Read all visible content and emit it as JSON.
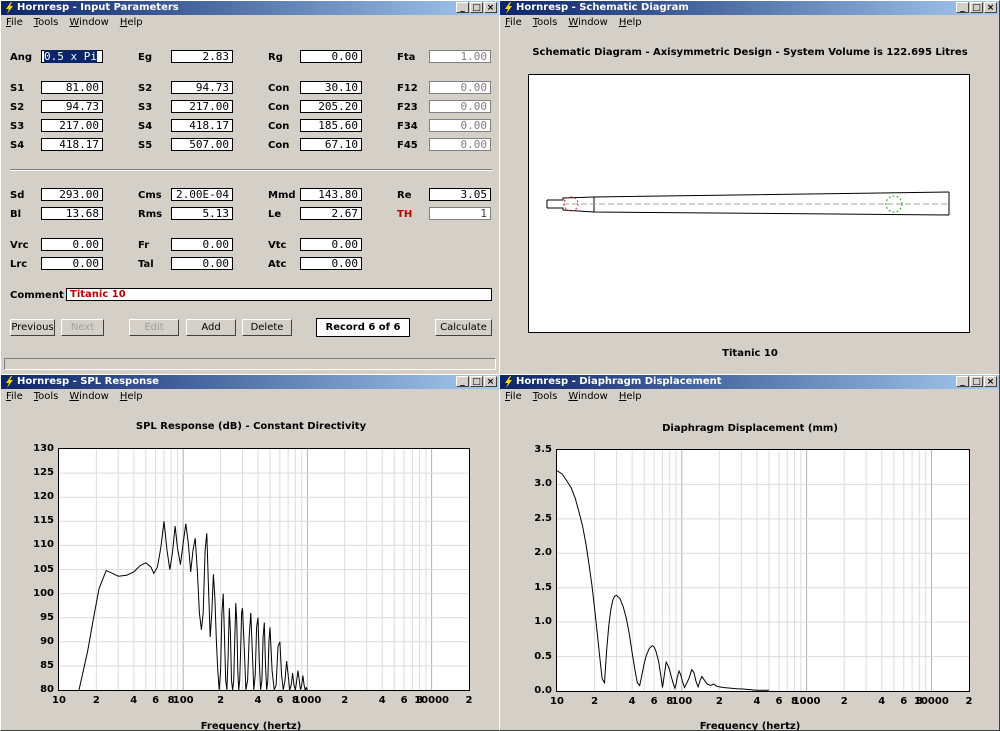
{
  "app_title": "Hornresp",
  "menu": [
    "File",
    "Tools",
    "Window",
    "Help"
  ],
  "windows": {
    "input": {
      "title": "Hornresp - Input Parameters"
    },
    "schematic": {
      "title": "Hornresp - Schematic Diagram",
      "heading": "Schematic Diagram - Axisymmetric Design - System Volume is 122.695 Litres",
      "caption": "Titanic 10"
    },
    "spl": {
      "title": "Hornresp - SPL Response"
    },
    "disp": {
      "title": "Hornresp - Diaphragm Displacement"
    }
  },
  "params": {
    "ang": {
      "label": "Ang",
      "value": "0.5 x Pi"
    },
    "eg": {
      "label": "Eg",
      "value": "2.83"
    },
    "rg": {
      "label": "Rg",
      "value": "0.00"
    },
    "fta": {
      "label": "Fta",
      "value": "1.00"
    },
    "s1": {
      "label": "S1",
      "value": "81.00"
    },
    "s2a": {
      "label": "S2",
      "value": "94.73"
    },
    "con1": {
      "label": "Con",
      "value": "30.10"
    },
    "f12": {
      "label": "F12",
      "value": "0.00"
    },
    "s2b": {
      "label": "S2",
      "value": "94.73"
    },
    "s3a": {
      "label": "S3",
      "value": "217.00"
    },
    "con2": {
      "label": "Con",
      "value": "205.20"
    },
    "f23": {
      "label": "F23",
      "value": "0.00"
    },
    "s3b": {
      "label": "S3",
      "value": "217.00"
    },
    "s4a": {
      "label": "S4",
      "value": "418.17"
    },
    "con3": {
      "label": "Con",
      "value": "185.60"
    },
    "f34": {
      "label": "F34",
      "value": "0.00"
    },
    "s4b": {
      "label": "S4",
      "value": "418.17"
    },
    "s5": {
      "label": "S5",
      "value": "507.00"
    },
    "con4": {
      "label": "Con",
      "value": "67.10"
    },
    "f45": {
      "label": "F45",
      "value": "0.00"
    },
    "sd": {
      "label": "Sd",
      "value": "293.00"
    },
    "cms": {
      "label": "Cms",
      "value": "2.00E-04"
    },
    "mmd": {
      "label": "Mmd",
      "value": "143.80"
    },
    "re": {
      "label": "Re",
      "value": "3.05"
    },
    "bl": {
      "label": "Bl",
      "value": "13.68"
    },
    "rms": {
      "label": "Rms",
      "value": "5.13"
    },
    "le": {
      "label": "Le",
      "value": "2.67"
    },
    "th": {
      "label": "TH",
      "value": "1"
    },
    "vrc": {
      "label": "Vrc",
      "value": "0.00"
    },
    "fr": {
      "label": "Fr",
      "value": "0.00"
    },
    "vtc": {
      "label": "Vtc",
      "value": "0.00"
    },
    "lrc": {
      "label": "Lrc",
      "value": "0.00"
    },
    "tal": {
      "label": "Tal",
      "value": "0.00"
    },
    "atc": {
      "label": "Atc",
      "value": "0.00"
    }
  },
  "comment": {
    "label": "Comment",
    "value": "Titanic 10"
  },
  "buttons": {
    "previous": "Previous",
    "next": "Next",
    "edit": "Edit",
    "add": "Add",
    "delete": "Delete",
    "record": "Record 6 of 6",
    "calculate": "Calculate"
  },
  "colors": {
    "accent_red": "#c00000",
    "title_blue": "#0a246a"
  },
  "chart_data": [
    {
      "type": "line",
      "title": "SPL Response (dB) - Constant Directivity",
      "xlabel": "Frequency (hertz)",
      "ylabel": "",
      "xscale": "log",
      "xlim": [
        10,
        20000
      ],
      "ylim": [
        80,
        130
      ],
      "yticks": [
        "130",
        "125",
        "120",
        "115",
        "110",
        "105",
        "100",
        "95",
        "90",
        "85",
        "80"
      ],
      "xticks": [
        "10",
        "2",
        "4",
        "6",
        "8",
        "100",
        "2",
        "4",
        "6",
        "8",
        "1000",
        "2",
        "4",
        "6",
        "8",
        "10000",
        "2"
      ],
      "grid": true,
      "series": [
        {
          "x": [
            14.5,
            17,
            19,
            21,
            24,
            27,
            30,
            35,
            40,
            45,
            50,
            55,
            58,
            62,
            66,
            70,
            74,
            78,
            82,
            86,
            90,
            95,
            100,
            105,
            110,
            115,
            120,
            125,
            130,
            135,
            140,
            145,
            150,
            155,
            160,
            165,
            170,
            175,
            180,
            185,
            190,
            195,
            200,
            205,
            210,
            215,
            220,
            225,
            230,
            235,
            240,
            245,
            250,
            255,
            260,
            265,
            270,
            275,
            280,
            285,
            290,
            295,
            300,
            310,
            320,
            330,
            340,
            350,
            360,
            370,
            380,
            390,
            400,
            410,
            420,
            430,
            440,
            450,
            460,
            470,
            480,
            490,
            500,
            520,
            540,
            560,
            580,
            600,
            620,
            640,
            660,
            680,
            700,
            720,
            740,
            760,
            780,
            800,
            820,
            840,
            860,
            880,
            900,
            920,
            940,
            960,
            980,
            1000
          ],
          "y": [
            80,
            88,
            95,
            101,
            104.8,
            104.2,
            103.6,
            103.8,
            104.5,
            105.8,
            106.4,
            105.5,
            104.2,
            105.5,
            109.5,
            115,
            109,
            105,
            108.5,
            114,
            109.5,
            106,
            110.5,
            114.5,
            110.5,
            104.5,
            109,
            111.5,
            104.5,
            96,
            92.5,
            96,
            109,
            112.5,
            100.5,
            91,
            96,
            104,
            99,
            90,
            84,
            80,
            84,
            96,
            100,
            91,
            82,
            80,
            87,
            97,
            92,
            82,
            80,
            82,
            90,
            98,
            94,
            84,
            80,
            82,
            88,
            96,
            97,
            89,
            80,
            82,
            91,
            96,
            88,
            80,
            83,
            93,
            95,
            86,
            80,
            82,
            91,
            94,
            85,
            80,
            82,
            90,
            93,
            84,
            80,
            81,
            89,
            90,
            83,
            80,
            82,
            86,
            83,
            80,
            81,
            83.5,
            81,
            80,
            82,
            84,
            82,
            80,
            81,
            83,
            81,
            80,
            80.5,
            80
          ]
        }
      ]
    },
    {
      "type": "line",
      "title": "Diaphragm Displacement (mm)",
      "xlabel": "Frequency (hertz)",
      "ylabel": "",
      "xscale": "log",
      "xlim": [
        10,
        20000
      ],
      "ylim": [
        0,
        3.5
      ],
      "yticks": [
        "3.5",
        "3.0",
        "2.5",
        "2.0",
        "1.5",
        "1.0",
        "0.5",
        "0.0"
      ],
      "xticks": [
        "10",
        "2",
        "4",
        "6",
        "8",
        "100",
        "2",
        "4",
        "6",
        "8",
        "1000",
        "2",
        "4",
        "6",
        "8",
        "10000",
        "2"
      ],
      "grid": true,
      "series": [
        {
          "x": [
            10,
            11,
            12,
            13,
            14,
            15,
            16,
            17,
            18,
            19,
            20,
            21,
            22,
            23,
            24,
            25,
            26,
            27,
            28,
            29,
            30,
            32,
            34,
            36,
            38,
            40,
            42,
            44,
            46,
            48,
            50,
            52,
            55,
            58,
            60,
            62,
            65,
            68,
            70,
            72,
            75,
            78,
            80,
            82,
            85,
            88,
            90,
            92,
            95,
            98,
            100,
            105,
            110,
            115,
            120,
            125,
            130,
            135,
            140,
            145,
            150,
            160,
            170,
            180,
            190,
            200,
            220,
            250,
            280,
            300,
            350,
            400,
            450,
            500
          ],
          "y": [
            3.2,
            3.15,
            3.05,
            2.95,
            2.8,
            2.6,
            2.4,
            2.15,
            1.85,
            1.55,
            1.2,
            0.85,
            0.5,
            0.18,
            0.12,
            0.6,
            0.95,
            1.18,
            1.32,
            1.38,
            1.39,
            1.34,
            1.22,
            1.05,
            0.82,
            0.56,
            0.32,
            0.12,
            0.08,
            0.24,
            0.4,
            0.52,
            0.62,
            0.66,
            0.64,
            0.58,
            0.44,
            0.22,
            0.05,
            0.2,
            0.42,
            0.36,
            0.3,
            0.22,
            0.12,
            0.04,
            0.1,
            0.2,
            0.29,
            0.24,
            0.17,
            0.05,
            0.12,
            0.2,
            0.31,
            0.27,
            0.14,
            0.06,
            0.15,
            0.21,
            0.17,
            0.1,
            0.08,
            0.1,
            0.07,
            0.06,
            0.05,
            0.04,
            0.03,
            0.03,
            0.02,
            0.01,
            0.01,
            0.01
          ]
        }
      ]
    }
  ]
}
